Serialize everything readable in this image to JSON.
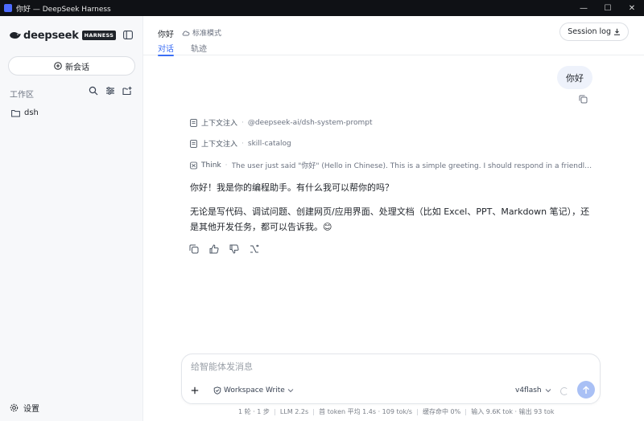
{
  "window": {
    "title": "你好 — DeepSeek Harness"
  },
  "sidebar": {
    "logo_text": "deepseek",
    "logo_badge": "HARNESS",
    "new_chat_label": "新会话",
    "workspace_label": "工作区",
    "folders": [
      "dsh"
    ],
    "settings_label": "设置"
  },
  "header": {
    "title": "你好",
    "mode": "标准模式",
    "tabs": [
      {
        "label": "对话",
        "active": true
      },
      {
        "label": "轨迹",
        "active": false
      }
    ],
    "session_log_label": "Session log"
  },
  "chat": {
    "user_message": "你好",
    "context_items": [
      {
        "label": "上下文注入",
        "value": "@deepseek-ai/dsh-system-prompt"
      },
      {
        "label": "上下文注入",
        "value": "skill-catalog"
      }
    ],
    "think": {
      "label": "Think",
      "text": "The user just said \"你好\" (Hello in Chinese). This is a simple greeting. I should respond in a friendly manner, ..."
    },
    "assistant_paragraphs": [
      "你好！我是你的编程助手。有什么我可以帮你的吗？",
      "无论是写代码、调试问题、创建网页/应用界面、处理文档（比如 Excel、PPT、Markdown 笔记），还是其他开发任务，都可以告诉我。😊"
    ]
  },
  "composer": {
    "placeholder": "给智能体发消息",
    "mode_label": "Workspace Write",
    "model_label": "v4flash"
  },
  "status": {
    "items": [
      "1 轮 · 1 步",
      "LLM 2.2s",
      "首 token 平均 1.4s · 109 tok/s",
      "缓存命中 0%",
      "输入 9.6K tok · 输出 93 tok"
    ]
  },
  "colors": {
    "accent": "#3b6ef5",
    "send_button": "#a9c0f5",
    "user_bubble": "#eef2fb",
    "sidebar_bg": "#f7f8fa",
    "titlebar_bg": "#0f1115"
  }
}
